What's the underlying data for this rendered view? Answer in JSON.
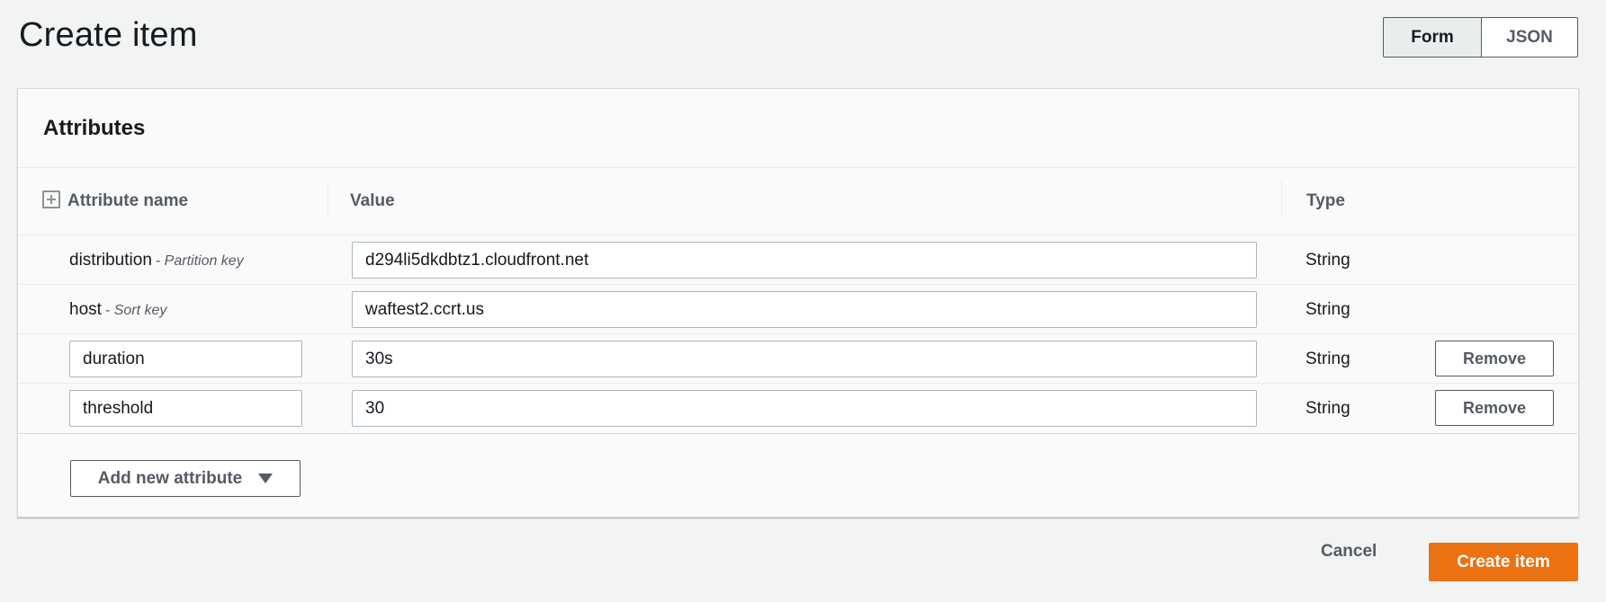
{
  "header": {
    "title": "Create item",
    "view_toggle": {
      "form_label": "Form",
      "json_label": "JSON",
      "selected": "Form"
    }
  },
  "attributes_panel": {
    "title": "Attributes",
    "columns": {
      "name": "Attribute name",
      "value": "Value",
      "type": "Type"
    },
    "rows": [
      {
        "name": "distribution",
        "key_hint": "- Partition key",
        "value": "d294li5dkdbtz1.cloudfront.net",
        "type": "String",
        "editable_name": false,
        "removable": false
      },
      {
        "name": "host",
        "key_hint": "- Sort key",
        "value": "waftest2.ccrt.us",
        "type": "String",
        "editable_name": false,
        "removable": false
      },
      {
        "name": "duration",
        "value": "30s",
        "type": "String",
        "editable_name": true,
        "removable": true,
        "remove_label": "Remove"
      },
      {
        "name": "threshold",
        "value": "30",
        "type": "String",
        "editable_name": true,
        "removable": true,
        "remove_label": "Remove"
      }
    ],
    "add_attribute_label": "Add new attribute"
  },
  "footer": {
    "cancel_label": "Cancel",
    "create_label": "Create item"
  },
  "colors": {
    "primary_button": "#ec7211",
    "background": "#f2f3f3",
    "text": "#16191f",
    "secondary_text": "#545b64"
  },
  "icons": {
    "expand": "plus-square-icon",
    "caret": "caret-down-icon"
  }
}
